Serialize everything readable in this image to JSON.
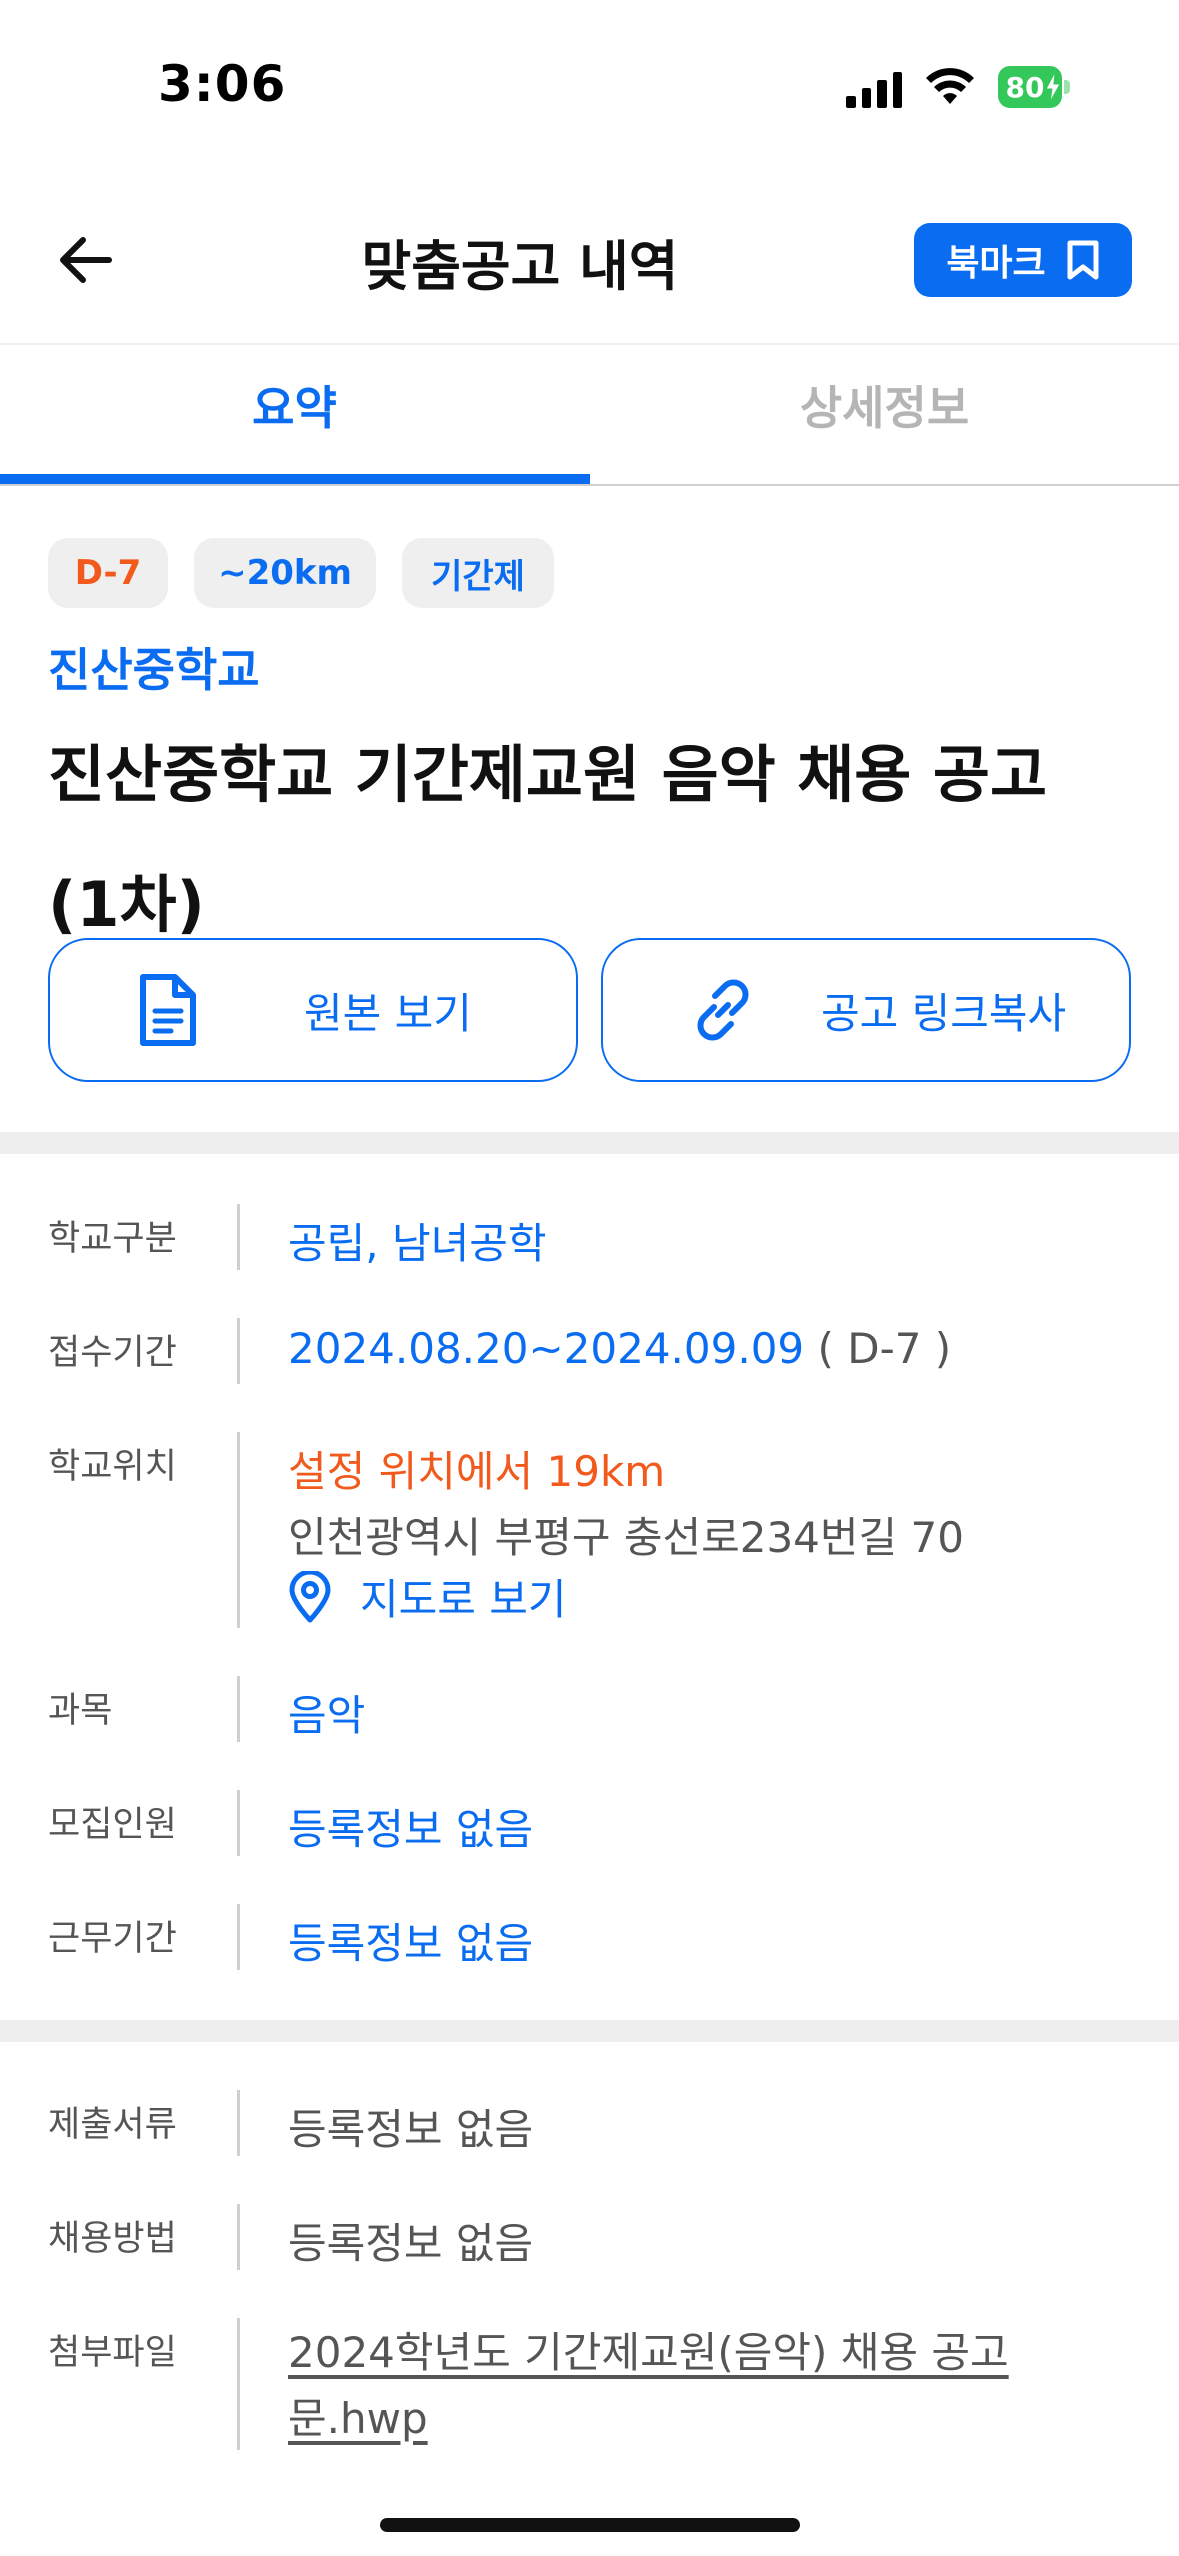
{
  "status_bar": {
    "time": "3:06",
    "battery": "80"
  },
  "header": {
    "title": "맞춤공고 내역",
    "bookmark_label": "북마크"
  },
  "tabs": [
    {
      "label": "요약",
      "active": true
    },
    {
      "label": "상세정보",
      "active": false
    }
  ],
  "chips": {
    "dday": "D-7",
    "distance": "~20km",
    "type": "기간제"
  },
  "posting": {
    "school": "진산중학교",
    "title": "진산중학교 기간제교원 음악 채용 공고(1차)"
  },
  "actions": {
    "view_original": "원본 보기",
    "copy_link": "공고 링크복사"
  },
  "info": {
    "school_type": {
      "label": "학교구분",
      "value": "공립, 남녀공학"
    },
    "period": {
      "label": "접수기간",
      "value": "2024.08.20~2024.09.09",
      "dday": " ( D-7 )"
    },
    "location": {
      "label": "학교위치",
      "distance": "설정 위치에서 19km",
      "address": "인천광역시 부평구 충선로234번길 70",
      "map_link": "지도로 보기"
    },
    "subject": {
      "label": "과목",
      "value": "음악"
    },
    "headcount": {
      "label": "모집인원",
      "value": "등록정보 없음"
    },
    "work_period": {
      "label": "근무기간",
      "value": "등록정보 없음"
    }
  },
  "extra": {
    "documents": {
      "label": "제출서류",
      "value": "등록정보 없음"
    },
    "method": {
      "label": "채용방법",
      "value": "등록정보 없음"
    },
    "attachment": {
      "label": "첨부파일",
      "value": "2024학년도 기간제교원(음악) 채용 공고문.hwp"
    }
  },
  "colors": {
    "accent": "#0a6cf0",
    "warning": "#f25a1d",
    "battery": "#34c759"
  }
}
